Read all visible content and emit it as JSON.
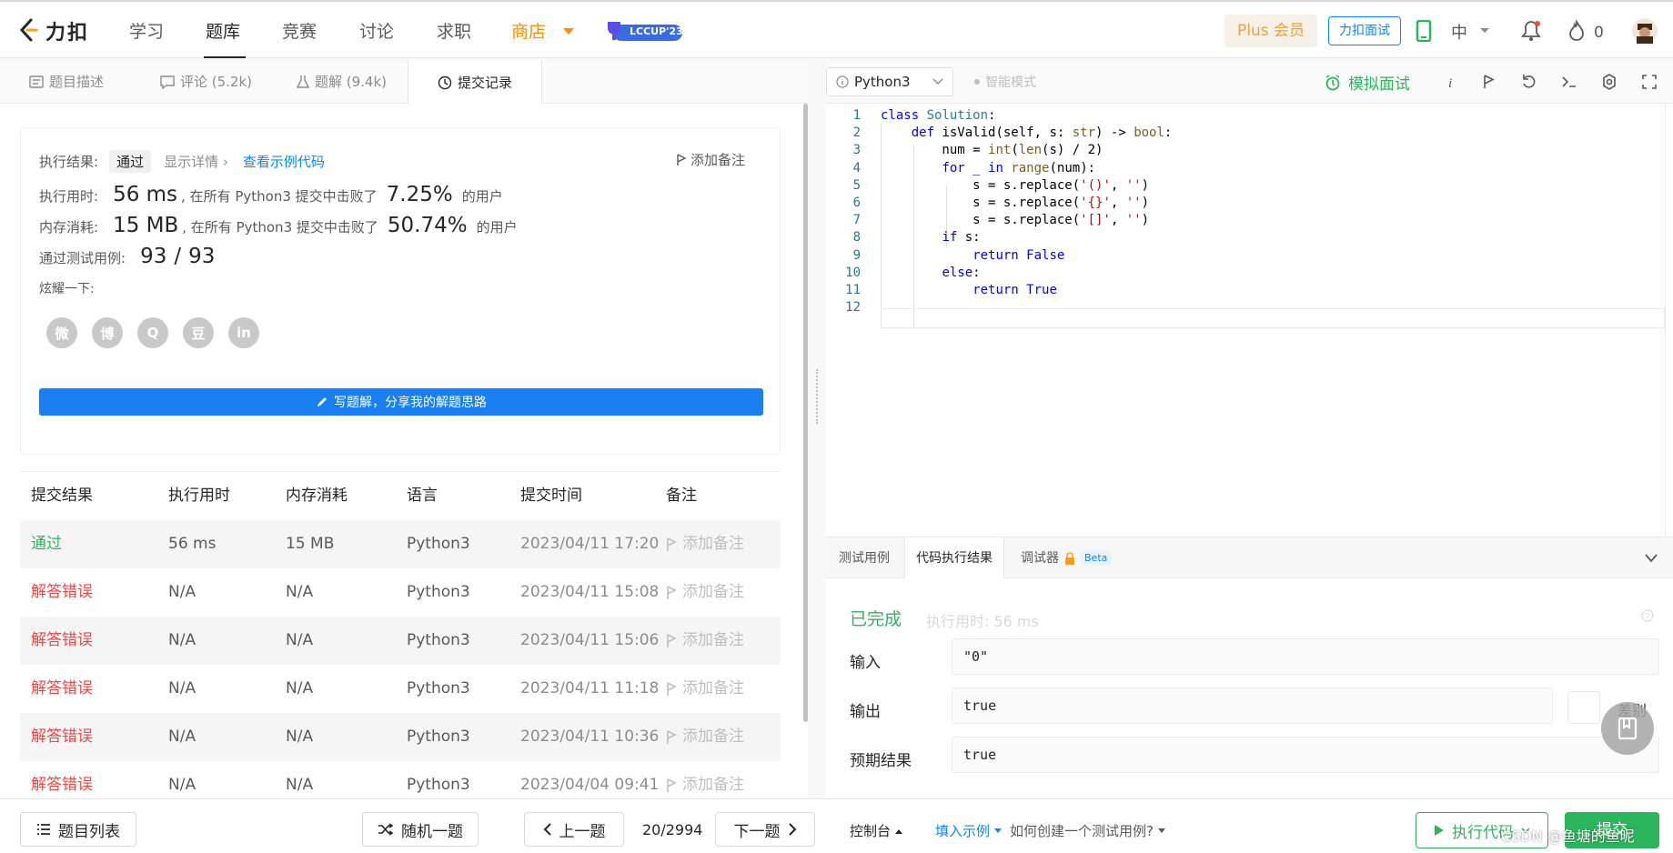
{
  "app": {
    "logo_text": "力扣"
  },
  "nav": {
    "items": [
      "学习",
      "题库",
      "竞赛",
      "讨论",
      "求职",
      "商店"
    ],
    "lccup_badge": "LCCUP'23",
    "plus": "Plus 会员",
    "interview": "力扣面试",
    "language": "中",
    "fire_count": "0"
  },
  "left_tabs": [
    {
      "label": "题目描述",
      "icon": "document-icon"
    },
    {
      "label": "评论 (5.2k)",
      "icon": "comment-icon"
    },
    {
      "label": "题解 (9.4k)",
      "icon": "flask-icon"
    },
    {
      "label": "提交记录",
      "icon": "clock-icon"
    }
  ],
  "result": {
    "label_result": "执行结果:",
    "status": "通过",
    "show_detail": "显示详情 ›",
    "view_sample": "查看示例代码",
    "add_note": "添加备注",
    "label_time": "执行用时:",
    "time_value": "56 ms",
    "time_mid": ", 在所有 Python3 提交中击败了",
    "time_pct": "7.25%",
    "time_suffix": "的用户",
    "label_mem": "内存消耗:",
    "mem_value": "15 MB",
    "mem_mid": ", 在所有 Python3 提交中击败了",
    "mem_pct": "50.74%",
    "mem_suffix": "的用户",
    "label_cases": "通过测试用例:",
    "cases_passed": "93",
    "cases_sep": "/",
    "cases_total": "93",
    "share_label": "炫耀一下:",
    "share_icons": [
      "wechat-icon",
      "weibo-icon",
      "qq-icon",
      "douban-icon",
      "linkedin-icon"
    ],
    "share_glyphs": [
      "微",
      "博",
      "Q",
      "豆",
      "in"
    ],
    "write_solution": "写题解，分享我的解题思路"
  },
  "submissions": {
    "headers": [
      "提交结果",
      "执行用时",
      "内存消耗",
      "语言",
      "提交时间",
      "备注"
    ],
    "rows": [
      {
        "status": "通过",
        "time": "56 ms",
        "mem": "15 MB",
        "lang": "Python3",
        "when": "2023/04/11 17:20",
        "note": "添加备注"
      },
      {
        "status": "解答错误",
        "time": "N/A",
        "mem": "N/A",
        "lang": "Python3",
        "when": "2023/04/11 15:08",
        "note": "添加备注"
      },
      {
        "status": "解答错误",
        "time": "N/A",
        "mem": "N/A",
        "lang": "Python3",
        "when": "2023/04/11 15:06",
        "note": "添加备注"
      },
      {
        "status": "解答错误",
        "time": "N/A",
        "mem": "N/A",
        "lang": "Python3",
        "when": "2023/04/11 11:18",
        "note": "添加备注"
      },
      {
        "status": "解答错误",
        "time": "N/A",
        "mem": "N/A",
        "lang": "Python3",
        "when": "2023/04/11 10:36",
        "note": "添加备注"
      },
      {
        "status": "解答错误",
        "time": "N/A",
        "mem": "N/A",
        "lang": "Python3",
        "when": "2023/04/04 09:41",
        "note": "添加备注"
      }
    ]
  },
  "editor_toolbar": {
    "language": "Python3",
    "smart_mode": "智能模式",
    "mock_interview": "模拟面试"
  },
  "code": {
    "lines": [
      "class Solution:",
      "    def isValid(self, s: str) -> bool:",
      "        num = int(len(s) / 2)",
      "        for _ in range(num):",
      "            s = s.replace('()', '')",
      "            s = s.replace('{}', '')",
      "            s = s.replace('[]', '')",
      "        if s:",
      "            return False",
      "        else:",
      "            return True",
      ""
    ]
  },
  "bottom_tabs": [
    "测试用例",
    "代码执行结果",
    "调试器"
  ],
  "beta_label": "Beta",
  "run_result": {
    "status": "已完成",
    "exec_time": "执行用时: 56 ms",
    "input_label": "输入",
    "input_value": "\"0\"",
    "output_label": "输出",
    "output_value": "true",
    "expected_label": "预期结果",
    "expected_value": "true",
    "diff_label": "差别"
  },
  "footer": {
    "problem_list": "题目列表",
    "random": "随机一题",
    "prev": "上一题",
    "page": "20/2994",
    "next": "下一题",
    "console": "控制台",
    "fill_example": "填入示例",
    "how_create": "如何创建一个测试用例?",
    "run_code": "执行代码",
    "submit": "提交"
  },
  "watermark": "CSDN @鱼塘的鱼呢",
  "colors": {
    "pass": "#2db55d",
    "fail": "#ef4743",
    "link": "#0a84ff",
    "shop": "#ff8c00"
  }
}
